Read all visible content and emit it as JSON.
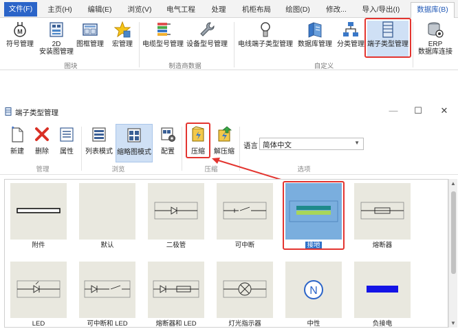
{
  "menubar": {
    "tabs": [
      "文件(F)",
      "主页(H)",
      "编辑(E)",
      "浏览(V)",
      "电气工程",
      "处理",
      "机柜布局",
      "绘图(D)",
      "修改...",
      "导入/导出(I)",
      "数据库(B)"
    ]
  },
  "ribbon": {
    "buttons": [
      "符号管理",
      "2D",
      "安装图管理",
      "图框管理",
      "宏管理",
      "电缆型号管理",
      "设备型号管理",
      "电线端子类型管理",
      "数据库管理",
      "分类管理",
      "端子类型管理",
      "ERP",
      "数据库连接"
    ],
    "groups": [
      "图块",
      "制造商数据",
      "自定义"
    ]
  },
  "dialog": {
    "title": "端子类型管理",
    "minimize": "—",
    "maximize": "☐",
    "close": "✕"
  },
  "toolbar": {
    "buttons": [
      "新建",
      "删除",
      "属性",
      "列表模式",
      "缩略图模式",
      "配置",
      "压缩",
      "解压缩"
    ],
    "groups": [
      "管理",
      "浏览",
      "压缩",
      "选项"
    ],
    "language_label": "语言",
    "language_value": "简体中文"
  },
  "terminals": [
    {
      "label": "附件"
    },
    {
      "label": "默认"
    },
    {
      "label": "二极管"
    },
    {
      "label": "可中断"
    },
    {
      "label": "接地",
      "selected": true
    },
    {
      "label": "熔断器"
    },
    {
      "label": "LED"
    },
    {
      "label": "可中断和 LED"
    },
    {
      "label": "熔断器和 LED"
    },
    {
      "label": "灯光指示器"
    },
    {
      "label": "中性"
    },
    {
      "label": "负接电"
    }
  ],
  "colors": {
    "accent": "#2b64c8",
    "highlight_red": "#e3342f",
    "thumb_bg": "#e9e8df",
    "selected_bg": "#7aaede"
  }
}
